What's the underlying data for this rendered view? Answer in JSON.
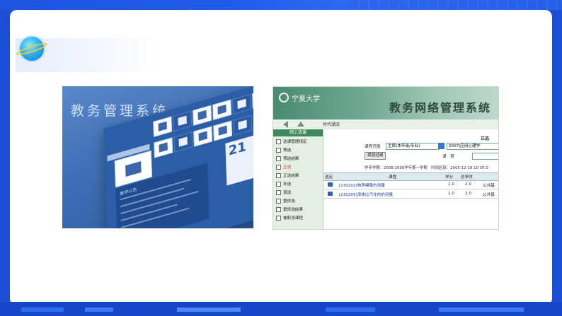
{
  "slide": {
    "left_image": {
      "title": "教务管理系统",
      "notice_label": "教学公告",
      "calendar_day": "21"
    },
    "right_image": {
      "logo_text": "宁夏大学",
      "system_title": "教务网络管理系统",
      "nav_title": "时代潮流",
      "sidebar": {
        "heading": "网上选课",
        "items": [
          {
            "label": "选课管理规定",
            "active": false
          },
          {
            "label": "预选",
            "active": false
          },
          {
            "label": "预选结果",
            "active": false
          },
          {
            "label": "正选",
            "active": true
          },
          {
            "label": "正选结果",
            "active": false
          },
          {
            "label": "补选",
            "active": false
          },
          {
            "label": "退选",
            "active": false
          },
          {
            "label": "重修选",
            "active": false
          },
          {
            "label": "重修选结果",
            "active": false
          },
          {
            "label": "被取消课程",
            "active": false
          }
        ]
      },
      "main": {
        "section_title": "正选",
        "course_scope_label": "课程范围",
        "course_scope_value": "主修(本年级/专业)",
        "course_value": "2007|应用心理学",
        "filter_button": "类别过滤",
        "course_label": "课　程",
        "term_info": "学年学期：2008-2009学年第一学期　时间区段：2005-12-18 10:35:0",
        "table": {
          "headers": [
            "选定",
            "课程",
            "学分",
            "总学时"
          ],
          "rows": [
            {
              "course": "[230202]物质模量的测量",
              "credit": "1.0",
              "hours": "2.0",
              "type": "公共基"
            },
            {
              "course": "[230205]滚体比汽化热的测量",
              "credit": "1.0",
              "hours": "2.0",
              "type": "公共基"
            }
          ]
        }
      }
    }
  }
}
